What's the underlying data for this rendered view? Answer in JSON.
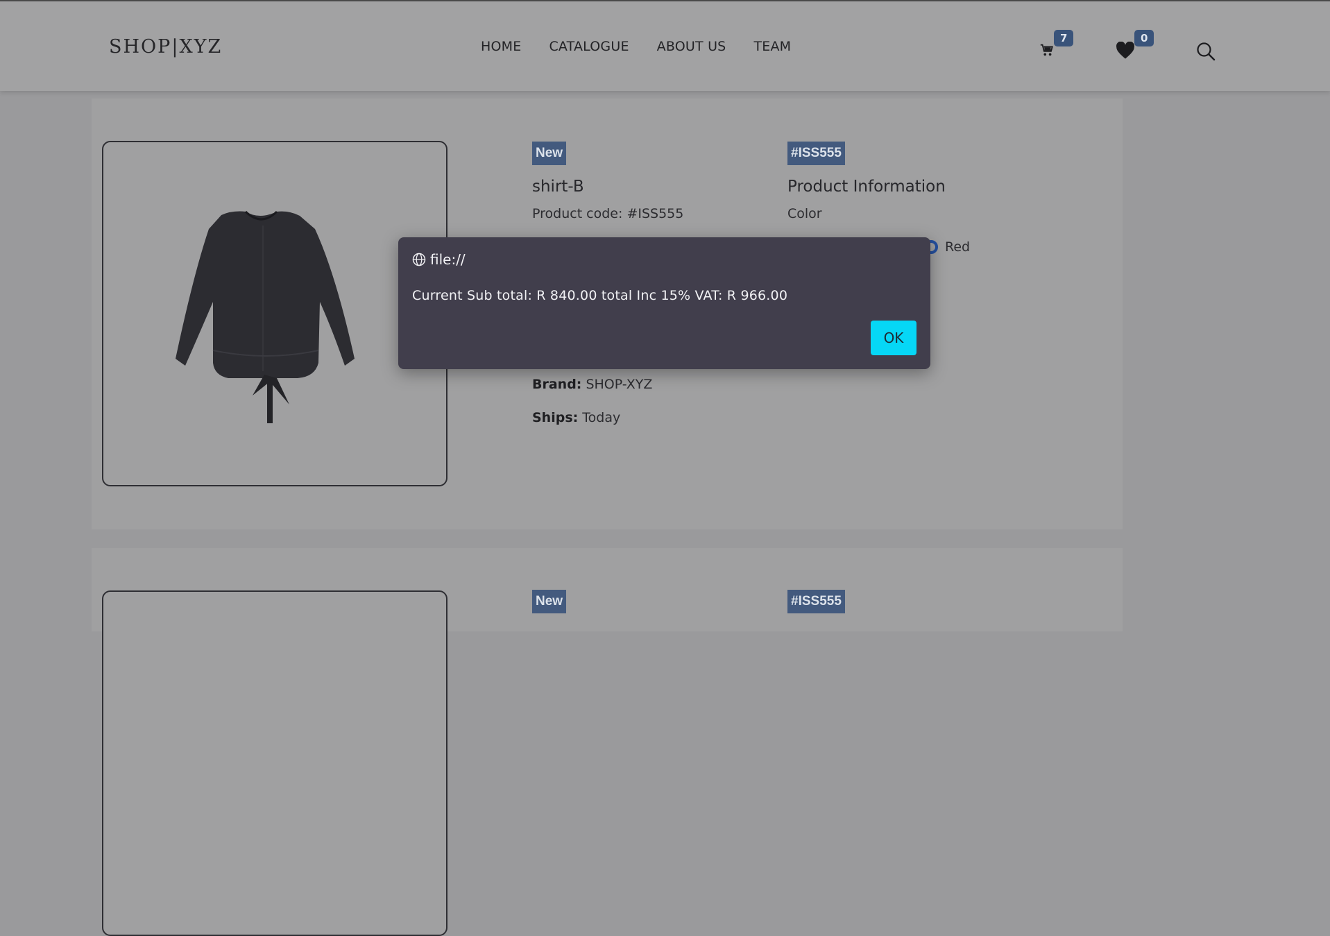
{
  "header": {
    "logo": "SHOP|XYZ",
    "nav": [
      "HOME",
      "CATALOGUE",
      "ABOUT US",
      "TEAM"
    ],
    "cart_count": "7",
    "wishlist_count": "0"
  },
  "products": [
    {
      "badge_new": "New",
      "title": "shirt-B",
      "code_text": "Product code: #ISS555",
      "code_badge": "#ISS555",
      "info_title": "Product Information",
      "color_label": "Color",
      "color_option": "Red",
      "brand_label": "Brand:",
      "brand_value": "SHOP-XYZ",
      "ships_label": "Ships:",
      "ships_value": "Today"
    },
    {
      "badge_new": "New",
      "code_badge": "#ISS555"
    }
  ],
  "dialog": {
    "origin": "file://",
    "message": "Current Sub total: R 840.00 total Inc 15% VAT: R 966.00",
    "ok_label": "OK"
  },
  "colors": {
    "badge": "#39537a",
    "ok_button": "#06d7f6",
    "dialog_bg": "#413e4c"
  }
}
